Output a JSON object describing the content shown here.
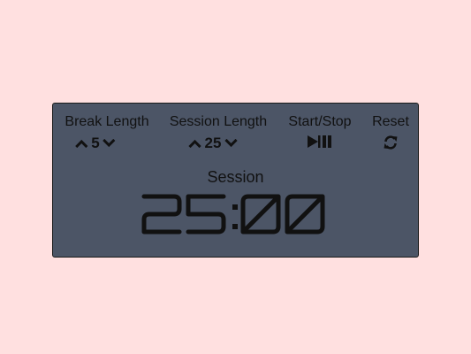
{
  "break": {
    "label": "Break Length",
    "value": "5"
  },
  "session": {
    "label": "Session Length",
    "value": "25"
  },
  "start_stop": {
    "label": "Start/Stop",
    "icon": "play-pause-icon"
  },
  "reset": {
    "label": "Reset",
    "icon": "refresh-icon"
  },
  "timer": {
    "label": "Session",
    "time": "25:00"
  }
}
